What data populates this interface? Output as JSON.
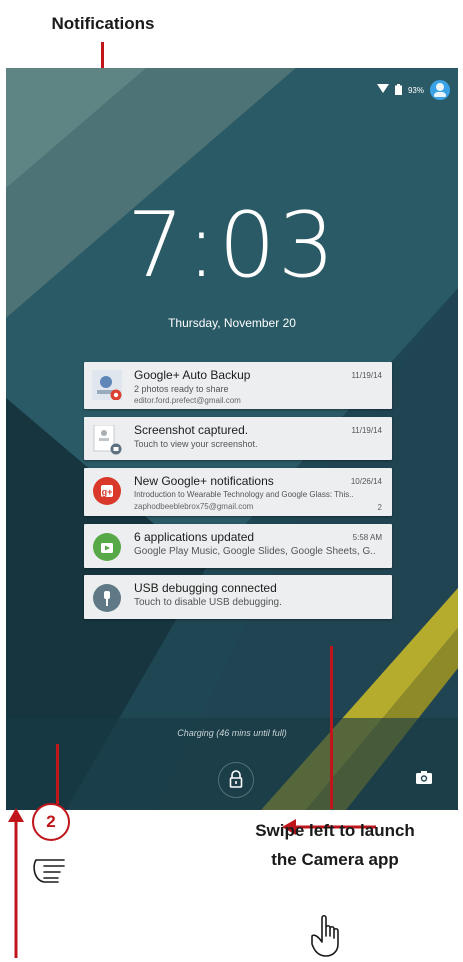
{
  "callouts": {
    "notifications": "Notifications",
    "swipe_line1": "Swipe left to launch",
    "swipe_line2": "the Camera app",
    "step_number": "2"
  },
  "status_bar": {
    "battery": "93%",
    "icons": [
      "wifi-icon",
      "battery-icon",
      "user-avatar-icon"
    ]
  },
  "lockscreen": {
    "time": "7:03",
    "date": "Thursday, November 20",
    "charging": "Charging (46 mins until full)"
  },
  "notifications": [
    {
      "icon": "photo-backup-icon",
      "title": "Google+ Auto Backup",
      "time": "11/19/14",
      "line1": "2 photos ready to share",
      "line2": "editor.ford.prefect@gmail.com"
    },
    {
      "icon": "screenshot-icon",
      "title": "Screenshot captured.",
      "time": "11/19/14",
      "line1": "Touch to view your screenshot."
    },
    {
      "icon": "google-plus-icon",
      "title": "New Google+ notifications",
      "time": "10/26/14",
      "line1": "Introduction to Wearable Technology and Google Glass: This..",
      "line2": "zaphodbeeblebrox75@gmail.com",
      "count": "2"
    },
    {
      "icon": "play-store-icon",
      "title": "6 applications updated",
      "time": "5:58 AM",
      "line1": "Google Play Music, Google Slides, Google Sheets, G.."
    },
    {
      "icon": "usb-debug-icon",
      "title": "USB debugging connected",
      "line1": "Touch to disable USB debugging."
    }
  ],
  "colors": {
    "accent_red": "#c0151a",
    "wallpaper_dark": "#1d3f4b",
    "notif_card": "#eceeef"
  }
}
